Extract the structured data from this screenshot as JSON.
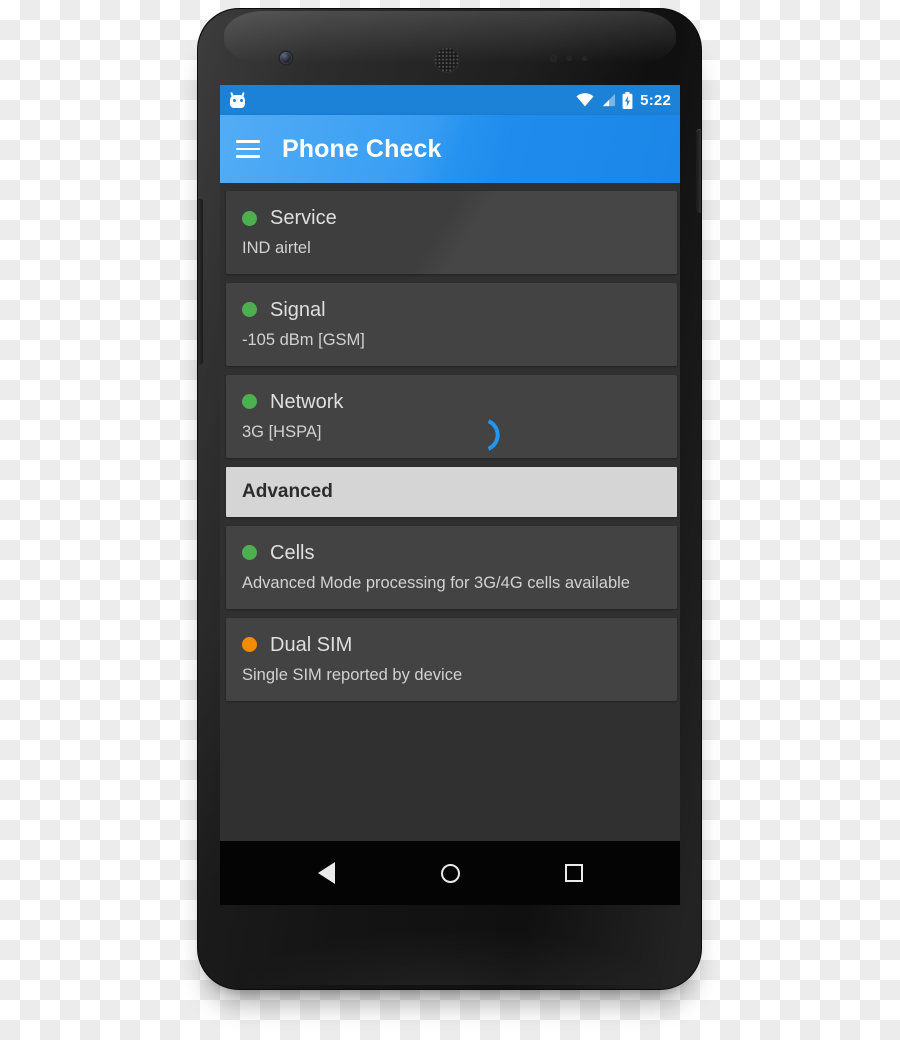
{
  "status_bar": {
    "notification_icon": "cyanogenmod-robot-icon",
    "wifi_icon": "wifi-icon",
    "signal_icon": "cell-signal-icon",
    "battery_icon": "battery-charging-icon",
    "time": "5:22",
    "background": "#1b82d8"
  },
  "app_bar": {
    "menu_icon": "hamburger-menu-icon",
    "title": "Phone Check",
    "background": "#2e99f2"
  },
  "colors": {
    "status_ok": "#4caf50",
    "status_warn": "#f28c00",
    "card": "#434343",
    "screen_bg": "#303030",
    "section_header_bg": "#d5d5d5",
    "accent_blue": "#2196f3"
  },
  "list": [
    {
      "kind": "card",
      "name": "service",
      "dot": "#4caf50",
      "title": "Service",
      "subtitle": "IND airtel",
      "spinner": false
    },
    {
      "kind": "card",
      "name": "signal",
      "dot": "#4caf50",
      "title": "Signal",
      "subtitle": "-105 dBm [GSM]",
      "spinner": false
    },
    {
      "kind": "card",
      "name": "network",
      "dot": "#4caf50",
      "title": "Network",
      "subtitle": "3G [HSPA]",
      "spinner": true
    },
    {
      "kind": "header",
      "name": "advanced",
      "title": "Advanced"
    },
    {
      "kind": "card",
      "name": "cells",
      "dot": "#4caf50",
      "title": "Cells",
      "subtitle": "Advanced Mode processing for 3G/4G cells available",
      "spinner": false
    },
    {
      "kind": "card",
      "name": "dual-sim",
      "dot": "#f28c00",
      "title": "Dual SIM",
      "subtitle": "Single SIM reported by device",
      "spinner": false
    }
  ],
  "nav_bar": {
    "back": "back-triangle-icon",
    "home": "home-circle-icon",
    "recents": "recents-square-icon"
  }
}
